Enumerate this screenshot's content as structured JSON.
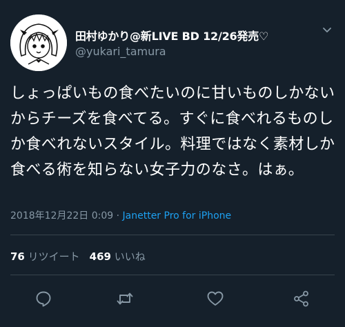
{
  "header": {
    "display_name": "田村ゆかり@新LIVE BD 12/26発売♡",
    "handle": "@yukari_tamura"
  },
  "tweet": {
    "text": "しょっぱいもの食べたいのに甘いものしかないからチーズを食べてる。すぐに食べれるものしか食べれないスタイル。料理ではなく素材しか食べる術を知らない女子力のなさ。はぁ。",
    "timestamp": "2018年12月22日 0:09",
    "separator": " · ",
    "source": "Janetter Pro for iPhone"
  },
  "stats": {
    "retweets_count": "76",
    "retweets_label": "リツイート",
    "likes_count": "469",
    "likes_label": "いいね"
  },
  "icons": {
    "caret": "chevron-down-icon",
    "reply": "reply-icon",
    "retweet": "retweet-icon",
    "like": "heart-icon",
    "share": "share-icon"
  },
  "colors": {
    "background": "#15202b",
    "text": "#ffffff",
    "secondary": "#8899a6",
    "link": "#1da1f2",
    "divider": "#38444d"
  }
}
